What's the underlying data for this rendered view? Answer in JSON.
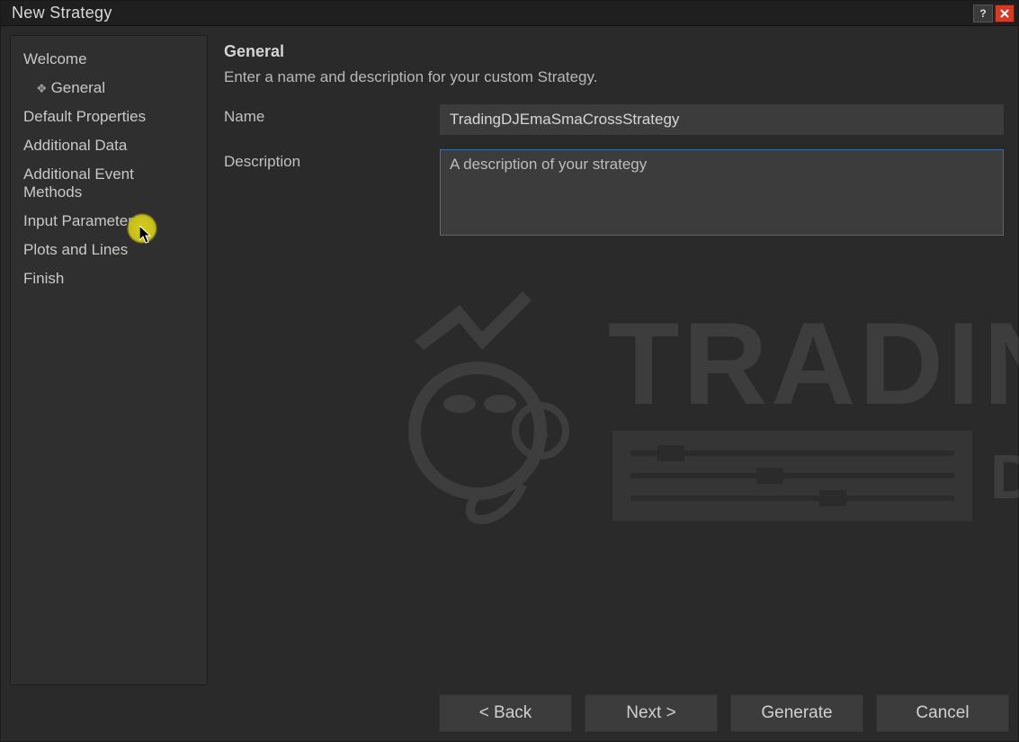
{
  "window": {
    "title": "New Strategy"
  },
  "sidebar": {
    "items": [
      {
        "label": "Welcome"
      },
      {
        "label": "General",
        "sub": true
      },
      {
        "label": "Default Properties"
      },
      {
        "label": "Additional Data"
      },
      {
        "label": "Additional Event Methods"
      },
      {
        "label": "Input Parameters"
      },
      {
        "label": "Plots and Lines"
      },
      {
        "label": "Finish"
      }
    ]
  },
  "main": {
    "heading": "General",
    "subheading": "Enter a name and description for your custom Strategy.",
    "name_label": "Name",
    "name_value": "TradingDJEmaSmaCrossStrategy",
    "desc_label": "Description",
    "desc_placeholder": "A description of your strategy"
  },
  "footer": {
    "back": "< Back",
    "next": "Next >",
    "generate": "Generate",
    "cancel": "Cancel"
  },
  "watermark": {
    "text1": "TRADING",
    "text2": "DJ"
  }
}
